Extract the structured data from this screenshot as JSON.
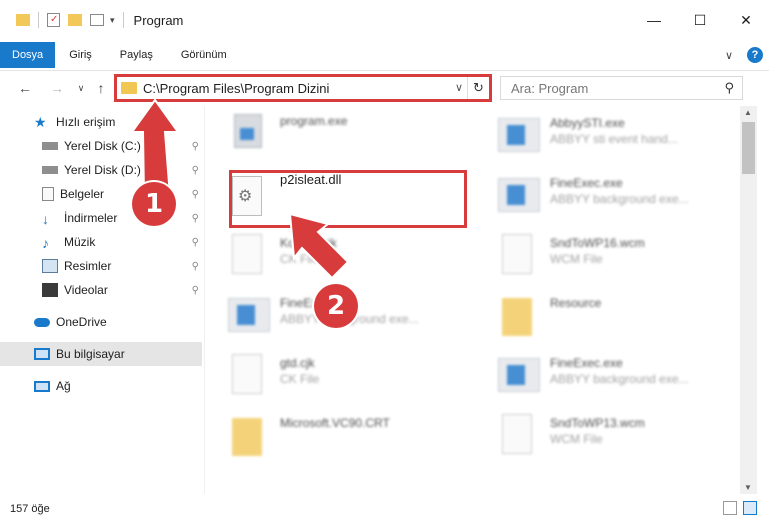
{
  "window": {
    "title": "Program",
    "minimize_glyph": "—",
    "maximize_glyph": "☐",
    "close_glyph": "✕"
  },
  "ribbon": {
    "tabs": [
      {
        "label": "Dosya",
        "active": true
      },
      {
        "label": "Giriş",
        "active": false
      },
      {
        "label": "Paylaş",
        "active": false
      },
      {
        "label": "Görünüm",
        "active": false
      }
    ],
    "help_label": "?",
    "expand_glyph": "∨"
  },
  "nav": {
    "back_glyph": "←",
    "forward_glyph": "→",
    "recent_glyph": "∨",
    "up_glyph": "↑"
  },
  "address": {
    "path": "C:\\Program Files\\Program Dizini",
    "refresh_glyph": "↻",
    "dropdown_glyph": "∨"
  },
  "search": {
    "placeholder": "Ara: Program",
    "icon_glyph": "⚲"
  },
  "sidebar": {
    "items": [
      {
        "label": "Hızlı erişim",
        "icon": "star-icon",
        "pinned": false
      },
      {
        "label": "Yerel Disk (C:)",
        "icon": "drive-icon",
        "pinned": true
      },
      {
        "label": "Yerel Disk (D:)",
        "icon": "drive-icon",
        "pinned": true
      },
      {
        "label": "Belgeler",
        "icon": "documents-icon",
        "pinned": true
      },
      {
        "label": "İndirmeler",
        "icon": "download-icon",
        "pinned": true
      },
      {
        "label": "Müzik",
        "icon": "music-icon",
        "pinned": true
      },
      {
        "label": "Resimler",
        "icon": "pictures-icon",
        "pinned": true
      },
      {
        "label": "Videolar",
        "icon": "video-icon",
        "pinned": true
      },
      {
        "label": "OneDrive",
        "icon": "cloud-icon",
        "pinned": false
      },
      {
        "label": "Bu bilgisayar",
        "icon": "computer-icon",
        "pinned": false,
        "selected": true
      },
      {
        "label": "Ağ",
        "icon": "network-icon",
        "pinned": false
      }
    ],
    "pin_glyph": "📌"
  },
  "files": [
    {
      "name": "program.exe",
      "desc": "",
      "icon": "installer-icon"
    },
    {
      "name": "AbbyySTI.exe",
      "desc": "ABBYY sti event hand...",
      "icon": "exe-icon"
    },
    {
      "name": "p2isleat.dll",
      "desc": "",
      "icon": "dll-icon"
    },
    {
      "name": "FineExec.exe",
      "desc": "ABBYY background exe...",
      "icon": "exe-icon"
    },
    {
      "name": "Korean.cjk",
      "desc": "CK File",
      "icon": "file-icon"
    },
    {
      "name": "SndToWP16.wcm",
      "desc": "WCM File",
      "icon": "file-icon"
    },
    {
      "name": "FineExec.exe",
      "desc": "ABBYY background exe...",
      "icon": "exe-icon"
    },
    {
      "name": "Resource",
      "desc": "",
      "icon": "folder-icon"
    },
    {
      "name": "gtd.cjk",
      "desc": "CK File",
      "icon": "file-icon"
    },
    {
      "name": "FineExec.exe",
      "desc": "ABBYY background exe...",
      "icon": "exe-icon"
    },
    {
      "name": "Microsoft.VC90.CRT",
      "desc": "",
      "icon": "folder-icon"
    },
    {
      "name": "SndToWP13.wcm",
      "desc": "WCM File",
      "icon": "file-icon"
    }
  ],
  "annotations": {
    "step1": "1",
    "step2": "2"
  },
  "status": {
    "item_count": "157 öğe"
  },
  "colors": {
    "accent": "#1979ca",
    "annotation_red": "#d83b3b",
    "folder_yellow": "#f2c859"
  }
}
